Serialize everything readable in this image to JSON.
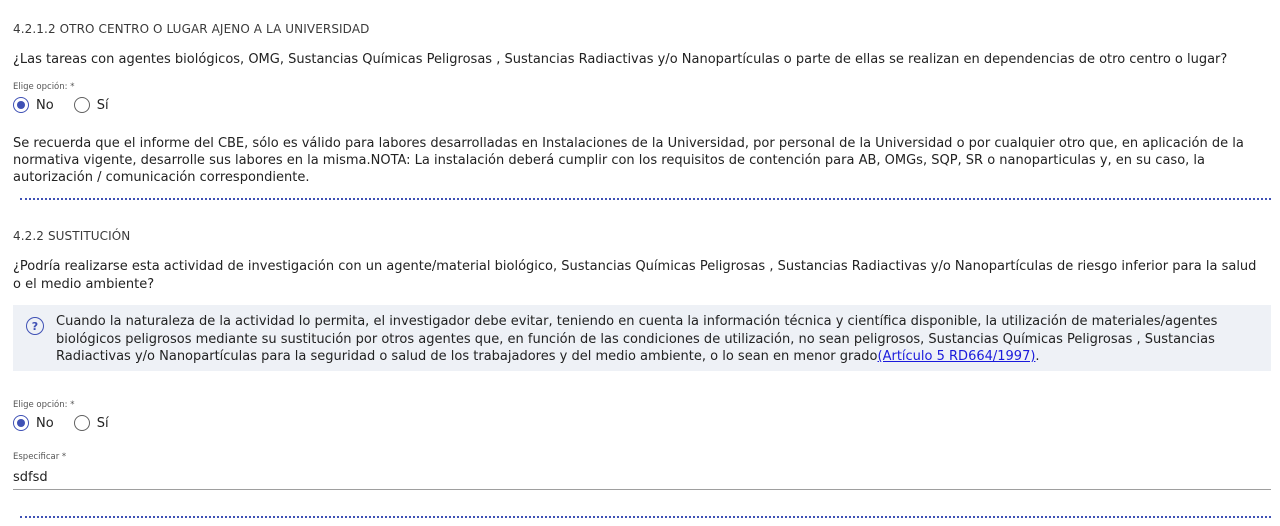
{
  "section1": {
    "title": "4.2.1.2 OTRO CENTRO O LUGAR AJENO A LA UNIVERSIDAD",
    "question": "¿Las tareas con agentes biológicos, OMG, Sustancias Químicas Peligrosas , Sustancias Radiactivas y/o Nanopartículas o parte de ellas se realizan en dependencias de otro centro o lugar?",
    "choice_label": "Elige opción: *",
    "options": [
      "No",
      "Sí"
    ],
    "selected": "No",
    "note": "Se recuerda que el informe del CBE, sólo es válido para labores desarrolladas en Instalaciones de la Universidad, por personal de la Universidad o por cualquier otro que, en aplicación de la normativa vigente, desarrolle sus labores en la misma.NOTA: La instalación deberá cumplir con los requisitos de contención para AB, OMGs, SQP, SR o nanoparticulas y, en su caso, la autorización / comunicación correspondiente."
  },
  "section2": {
    "title": "4.2.2 SUSTITUCIÓN",
    "question": "¿Podría realizarse esta actividad de investigación con un agente/material biológico, Sustancias Químicas Peligrosas , Sustancias Radiactivas y/o Nanopartículas de riesgo inferior para la salud o el medio ambiente?",
    "info_icon": "help-circle-icon",
    "info_text": "Cuando la naturaleza de la actividad lo permita, el investigador debe evitar, teniendo en cuenta la información técnica y científica disponible, la utilización de materiales/agentes biológicos peligrosos mediante su sustitución por otros agentes que, en función de las condiciones de utilización, no sean peligrosos, Sustancias Químicas Peligrosas , Sustancias Radiactivas y/o Nanopartículas para la seguridad o salud de los trabajadores y del medio ambiente, o lo sean en menor grado",
    "info_link": "(Artículo 5 RD664/1997)",
    "info_end": ".",
    "choice_label": "Elige opción: *",
    "options": [
      "No",
      "Sí"
    ],
    "selected": "No",
    "specify_label": "Especificar *",
    "specify_value": "sdfsd"
  },
  "colors": {
    "accent": "#3f51b5",
    "info_bg": "#eef1f6",
    "link": "#1a1adc"
  }
}
